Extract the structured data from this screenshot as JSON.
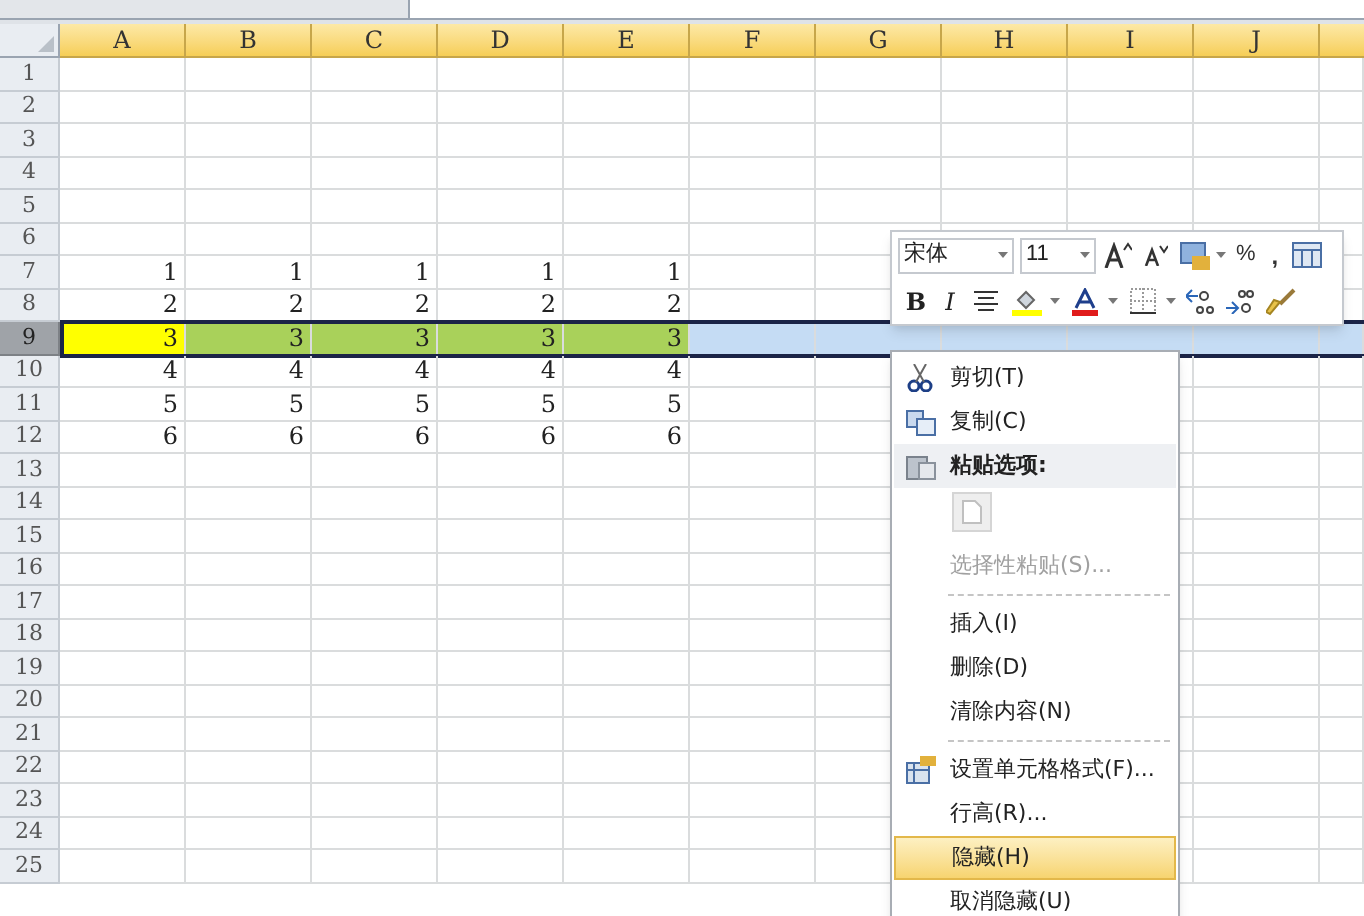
{
  "columns": [
    "A",
    "B",
    "C",
    "D",
    "E",
    "F",
    "G",
    "H",
    "I",
    "J"
  ],
  "rows": [
    {
      "number": "1",
      "selected": false,
      "cells": []
    },
    {
      "number": "2",
      "selected": false,
      "cells": []
    },
    {
      "number": "3",
      "selected": false,
      "cells": []
    },
    {
      "number": "4",
      "selected": false,
      "cells": []
    },
    {
      "number": "5",
      "selected": false,
      "cells": []
    },
    {
      "number": "6",
      "selected": false,
      "cells": []
    },
    {
      "number": "7",
      "selected": false,
      "cells": [
        {
          "value": "1"
        },
        {
          "value": "1"
        },
        {
          "value": "1"
        },
        {
          "value": "1"
        },
        {
          "value": "1"
        }
      ]
    },
    {
      "number": "8",
      "selected": false,
      "cells": [
        {
          "value": "2"
        },
        {
          "value": "2"
        },
        {
          "value": "2"
        },
        {
          "value": "2"
        },
        {
          "value": "2"
        }
      ]
    },
    {
      "number": "9",
      "selected": true,
      "cells": [
        {
          "value": "3",
          "color": "#ffff00"
        },
        {
          "value": "3",
          "color": "#a9d15a"
        },
        {
          "value": "3",
          "color": "#a9d15a"
        },
        {
          "value": "3",
          "color": "#a9d15a"
        },
        {
          "value": "3",
          "color": "#a9d15a"
        }
      ]
    },
    {
      "number": "10",
      "selected": false,
      "cells": [
        {
          "value": "4"
        },
        {
          "value": "4"
        },
        {
          "value": "4"
        },
        {
          "value": "4"
        },
        {
          "value": "4"
        }
      ]
    },
    {
      "number": "11",
      "selected": false,
      "cells": [
        {
          "value": "5"
        },
        {
          "value": "5"
        },
        {
          "value": "5"
        },
        {
          "value": "5"
        },
        {
          "value": "5"
        }
      ]
    },
    {
      "number": "12",
      "selected": false,
      "cells": [
        {
          "value": "6"
        },
        {
          "value": "6"
        },
        {
          "value": "6"
        },
        {
          "value": "6"
        },
        {
          "value": "6"
        }
      ]
    },
    {
      "number": "13",
      "selected": false,
      "cells": []
    },
    {
      "number": "14",
      "selected": false,
      "cells": []
    },
    {
      "number": "15",
      "selected": false,
      "cells": []
    },
    {
      "number": "16",
      "selected": false,
      "cells": []
    },
    {
      "number": "17",
      "selected": false,
      "cells": []
    },
    {
      "number": "18",
      "selected": false,
      "cells": []
    },
    {
      "number": "19",
      "selected": false,
      "cells": []
    },
    {
      "number": "20",
      "selected": false,
      "cells": []
    },
    {
      "number": "21",
      "selected": false,
      "cells": []
    },
    {
      "number": "22",
      "selected": false,
      "cells": []
    },
    {
      "number": "23",
      "selected": false,
      "cells": []
    },
    {
      "number": "24",
      "selected": false,
      "cells": []
    },
    {
      "number": "25",
      "selected": false,
      "cells": []
    }
  ],
  "mini_toolbar": {
    "font": "宋体",
    "size": "11",
    "percent": "%",
    "comma": ",",
    "bold": "B",
    "italic": "I"
  },
  "context_menu": [
    {
      "kind": "cut",
      "label": "剪切(T)",
      "disabled": false,
      "selected": false
    },
    {
      "kind": "copy",
      "label": "复制(C)",
      "disabled": false,
      "selected": false
    },
    {
      "kind": "header",
      "label": "粘贴选项:"
    },
    {
      "kind": "paste"
    },
    {
      "kind": "item",
      "label": "选择性粘贴(S)...",
      "disabled": true,
      "selected": false
    },
    {
      "kind": "separator"
    },
    {
      "kind": "item",
      "label": "插入(I)",
      "disabled": false,
      "selected": false
    },
    {
      "kind": "item",
      "label": "删除(D)",
      "disabled": false,
      "selected": false
    },
    {
      "kind": "item",
      "label": "清除内容(N)",
      "disabled": false,
      "selected": false
    },
    {
      "kind": "separator"
    },
    {
      "kind": "format",
      "label": "设置单元格格式(F)...",
      "disabled": false,
      "selected": false
    },
    {
      "kind": "item",
      "label": "行高(R)...",
      "disabled": false,
      "selected": false
    },
    {
      "kind": "item",
      "label": "隐藏(H)",
      "disabled": false,
      "selected": true
    },
    {
      "kind": "item",
      "label": "取消隐藏(U)",
      "disabled": false,
      "selected": false
    }
  ]
}
